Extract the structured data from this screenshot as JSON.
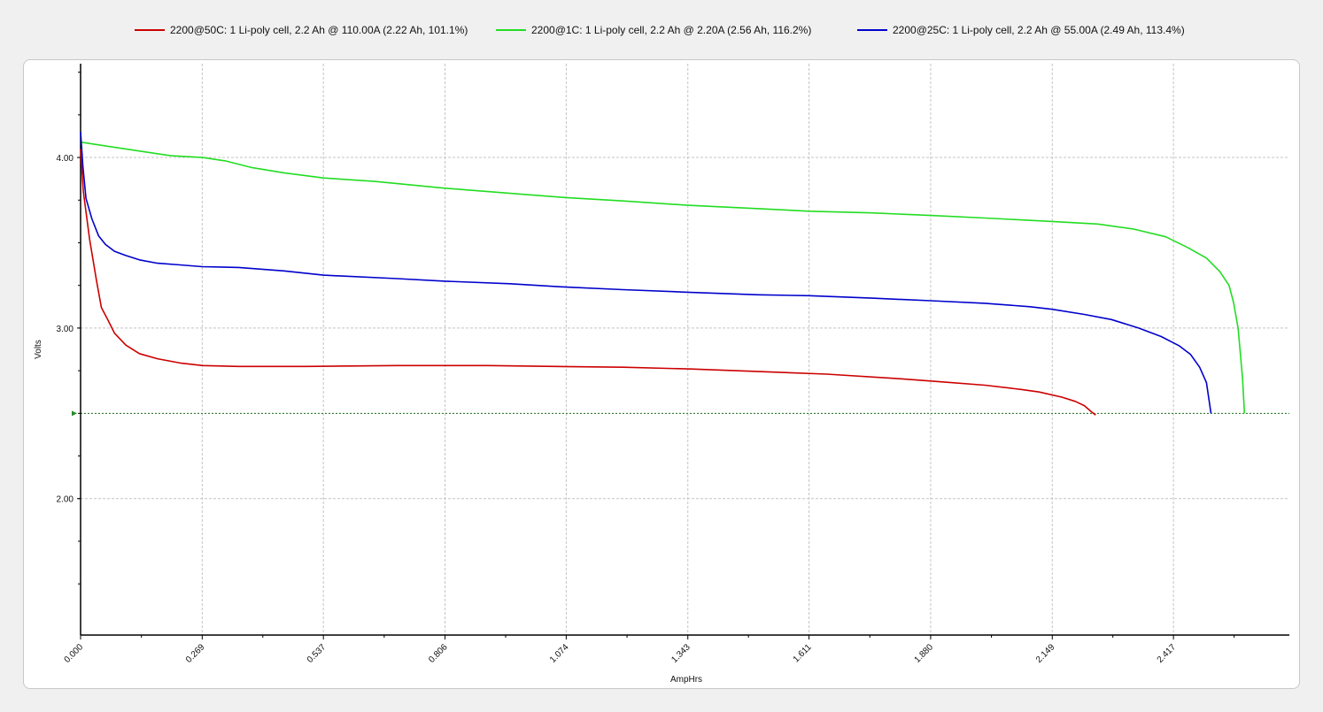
{
  "chart_data": {
    "type": "line",
    "title": "",
    "xlabel": "AmpHrs",
    "ylabel": "Volts",
    "xlim": [
      0.0,
      2.68
    ],
    "ylim": [
      1.2,
      4.55
    ],
    "grid": true,
    "legend_position": "top",
    "x_ticks": [
      "0.000",
      "0.269",
      "0.537",
      "0.806",
      "1.074",
      "1.343",
      "1.611",
      "1.880",
      "2.149",
      "2.417"
    ],
    "y_ticks": [
      "2.00",
      "3.00",
      "4.00"
    ],
    "cutoff_voltage": 2.5,
    "series": [
      {
        "name": "2200@50C: 1 Li-poly cell, 2.2 Ah @ 110.00A (2.22 Ah, 101.1%)",
        "color": "#cc0000",
        "points": [
          [
            0.0,
            4.05
          ],
          [
            0.006,
            3.8
          ],
          [
            0.02,
            3.52
          ],
          [
            0.035,
            3.28
          ],
          [
            0.046,
            3.12
          ],
          [
            0.06,
            3.05
          ],
          [
            0.075,
            2.97
          ],
          [
            0.1,
            2.9
          ],
          [
            0.13,
            2.85
          ],
          [
            0.17,
            2.82
          ],
          [
            0.22,
            2.795
          ],
          [
            0.27,
            2.78
          ],
          [
            0.35,
            2.775
          ],
          [
            0.5,
            2.775
          ],
          [
            0.7,
            2.78
          ],
          [
            0.9,
            2.78
          ],
          [
            1.05,
            2.775
          ],
          [
            1.2,
            2.77
          ],
          [
            1.35,
            2.76
          ],
          [
            1.5,
            2.745
          ],
          [
            1.65,
            2.73
          ],
          [
            1.8,
            2.705
          ],
          [
            1.9,
            2.685
          ],
          [
            2.0,
            2.665
          ],
          [
            2.08,
            2.64
          ],
          [
            2.12,
            2.625
          ],
          [
            2.17,
            2.595
          ],
          [
            2.2,
            2.57
          ],
          [
            2.22,
            2.545
          ],
          [
            2.235,
            2.51
          ],
          [
            2.245,
            2.49
          ]
        ]
      },
      {
        "name": "2200@1C: 1 Li-poly cell, 2.2 Ah @ 2.20A (2.56 Ah, 116.2%)",
        "color": "#22dd22",
        "points": [
          [
            0.0,
            4.09
          ],
          [
            0.05,
            4.07
          ],
          [
            0.1,
            4.05
          ],
          [
            0.15,
            4.03
          ],
          [
            0.2,
            4.01
          ],
          [
            0.27,
            4.0
          ],
          [
            0.32,
            3.98
          ],
          [
            0.38,
            3.94
          ],
          [
            0.45,
            3.91
          ],
          [
            0.537,
            3.88
          ],
          [
            0.65,
            3.86
          ],
          [
            0.806,
            3.82
          ],
          [
            0.95,
            3.79
          ],
          [
            1.074,
            3.765
          ],
          [
            1.2,
            3.745
          ],
          [
            1.343,
            3.72
          ],
          [
            1.5,
            3.7
          ],
          [
            1.611,
            3.685
          ],
          [
            1.75,
            3.675
          ],
          [
            1.88,
            3.66
          ],
          [
            2.0,
            3.645
          ],
          [
            2.149,
            3.625
          ],
          [
            2.25,
            3.61
          ],
          [
            2.33,
            3.58
          ],
          [
            2.4,
            3.535
          ],
          [
            2.45,
            3.47
          ],
          [
            2.49,
            3.41
          ],
          [
            2.52,
            3.33
          ],
          [
            2.54,
            3.25
          ],
          [
            2.55,
            3.15
          ],
          [
            2.56,
            3.0
          ],
          [
            2.565,
            2.85
          ],
          [
            2.57,
            2.7
          ],
          [
            2.574,
            2.5
          ]
        ]
      },
      {
        "name": "2200@25C: 1 Li-poly cell, 2.2 Ah @ 55.00A (2.49 Ah, 113.4%)",
        "color": "#0000cc",
        "points": [
          [
            0.0,
            4.15
          ],
          [
            0.005,
            3.95
          ],
          [
            0.012,
            3.76
          ],
          [
            0.025,
            3.64
          ],
          [
            0.04,
            3.54
          ],
          [
            0.055,
            3.49
          ],
          [
            0.075,
            3.45
          ],
          [
            0.1,
            3.425
          ],
          [
            0.13,
            3.4
          ],
          [
            0.17,
            3.38
          ],
          [
            0.22,
            3.37
          ],
          [
            0.269,
            3.36
          ],
          [
            0.35,
            3.355
          ],
          [
            0.45,
            3.335
          ],
          [
            0.537,
            3.31
          ],
          [
            0.7,
            3.29
          ],
          [
            0.806,
            3.275
          ],
          [
            0.95,
            3.26
          ],
          [
            1.074,
            3.24
          ],
          [
            1.2,
            3.225
          ],
          [
            1.343,
            3.21
          ],
          [
            1.5,
            3.195
          ],
          [
            1.611,
            3.19
          ],
          [
            1.75,
            3.175
          ],
          [
            1.88,
            3.16
          ],
          [
            2.0,
            3.145
          ],
          [
            2.1,
            3.125
          ],
          [
            2.149,
            3.11
          ],
          [
            2.22,
            3.08
          ],
          [
            2.28,
            3.05
          ],
          [
            2.34,
            3.0
          ],
          [
            2.39,
            2.95
          ],
          [
            2.43,
            2.895
          ],
          [
            2.455,
            2.845
          ],
          [
            2.475,
            2.77
          ],
          [
            2.49,
            2.68
          ],
          [
            2.5,
            2.5
          ]
        ]
      }
    ]
  }
}
